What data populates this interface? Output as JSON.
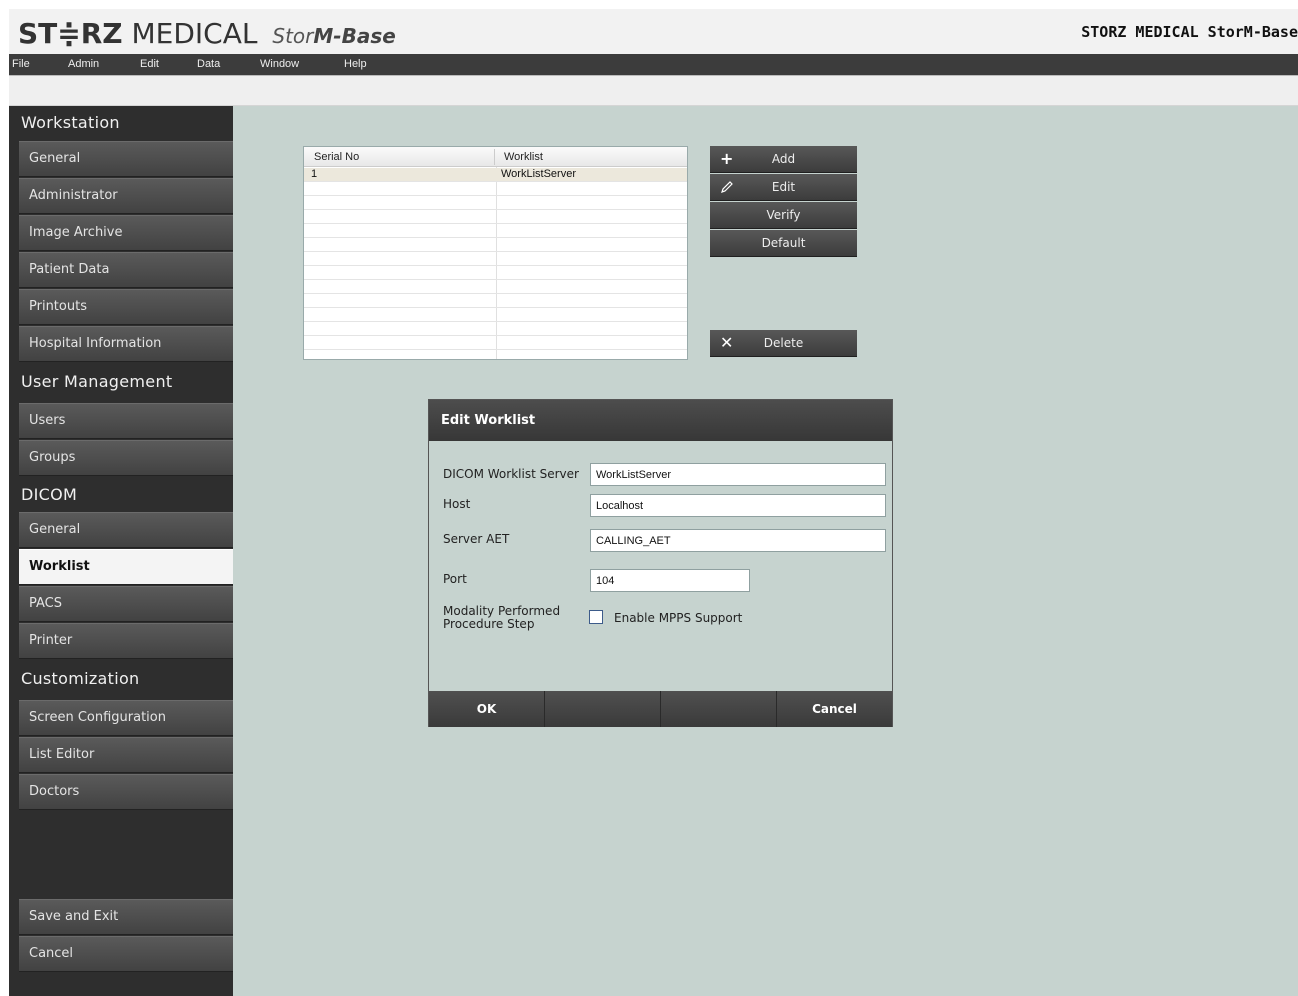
{
  "app": {
    "logo_bold": "ST≑RZ",
    "logo_light": "MEDICAL",
    "logo_sub_a": "Stor",
    "logo_sub_b": "M-Base",
    "window_title": "STORZ MEDICAL StorM-Base"
  },
  "menu": [
    "File",
    "Admin",
    "Edit",
    "Data",
    "Window",
    "Help"
  ],
  "sidebar": {
    "workstation": {
      "heading": "Workstation",
      "items": [
        "General",
        "Administrator",
        "Image Archive",
        "Patient Data",
        "Printouts",
        "Hospital Information"
      ]
    },
    "user_management": {
      "heading": "User Management",
      "items": [
        "Users",
        "Groups"
      ]
    },
    "dicom": {
      "heading": "DICOM",
      "items": [
        "General",
        "Worklist",
        "PACS",
        "Printer"
      ],
      "active": "Worklist"
    },
    "customization": {
      "heading": "Customization",
      "items": [
        "Screen Configuration",
        "List Editor",
        "Doctors"
      ]
    },
    "footer_items": [
      "Save and Exit",
      "Cancel"
    ]
  },
  "table": {
    "columns": [
      "Serial No",
      "Worklist"
    ],
    "rows": [
      [
        "1",
        "WorkListServer"
      ]
    ]
  },
  "actions": {
    "add": "Add",
    "edit": "Edit",
    "verify": "Verify",
    "default": "Default",
    "delete": "Delete"
  },
  "dialog": {
    "title": "Edit Worklist",
    "fields": {
      "server_label": "DICOM Worklist Server",
      "server_value": "WorkListServer",
      "host_label": "Host",
      "host_value": "Localhost",
      "aet_label": "Server AET",
      "aet_value": "CALLING_AET",
      "port_label": "Port",
      "port_value": "104",
      "mpps_label_1": "Modality Performed",
      "mpps_label_2": "Procedure Step",
      "mpps_checkbox": "Enable MPPS Support",
      "mpps_checked": false
    },
    "ok": "OK",
    "cancel": "Cancel"
  }
}
